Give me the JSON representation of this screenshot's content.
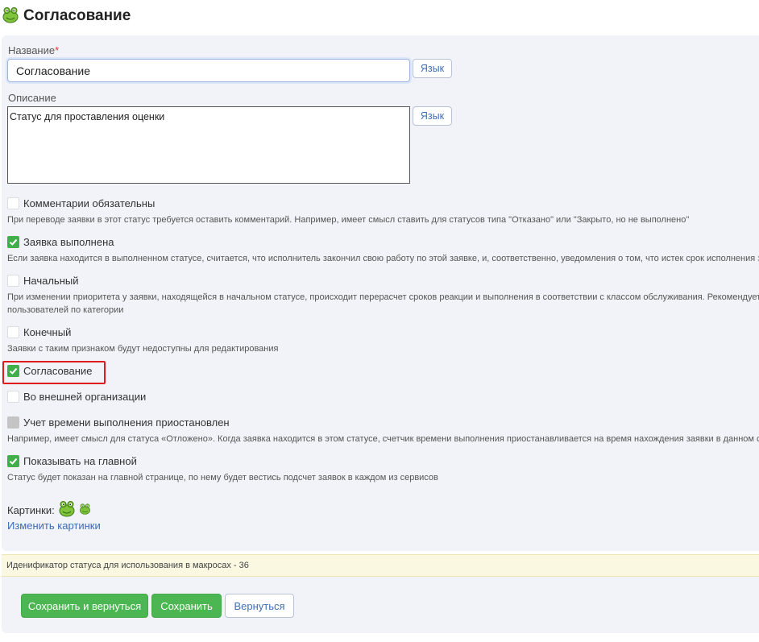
{
  "header": {
    "title": "Согласование",
    "icon": "frog-icon"
  },
  "form": {
    "name_label": "Название",
    "required_mark": "*",
    "name_value": "Согласование",
    "lang_label": "Язык",
    "description_label": "Описание",
    "description_value": "Статус для проставления оценки"
  },
  "options": [
    {
      "label": "Комментарии обязательны",
      "checked": false,
      "disabled": false,
      "hint": "При переводе заявки в этот статус требуется оставить комментарий. Например, имеет смысл ставить для статусов типа \"Отказано\" или \"Закрыто, но не выполнено\""
    },
    {
      "label": "Заявка выполнена",
      "checked": true,
      "disabled": false,
      "hint": "Если заявка находится в выполненном статусе, считается, что исполнитель закончил свою работу по этой заявке, и, соответственно, уведомления о том, что истек срок исполнения за"
    },
    {
      "label": "Начальный",
      "checked": false,
      "disabled": false,
      "hint": "При изменении приоритета у заявки, находящейся в начальном статусе, происходит перерасчет сроков реакции и выполнения в соответствии с классом обслуживания. Рекомендуетс",
      "hint2": "пользователей по категории"
    },
    {
      "label": "Конечный",
      "checked": false,
      "disabled": false,
      "hint": "Заявки с таким признаком будут недоступны для редактирования"
    },
    {
      "label": "Согласование",
      "checked": true,
      "disabled": false
    },
    {
      "label": "Во внешней организации",
      "checked": false,
      "disabled": false
    },
    {
      "label": "Учет времени выполнения приостановлен",
      "checked": false,
      "disabled": true,
      "hint": "Например, имеет смысл для статуса «Отложено». Когда заявка находится в этом статусе, счетчик времени выполнения приостанавливается на время нахождения заявки в данном стат"
    },
    {
      "label": "Показывать на главной",
      "checked": true,
      "disabled": false,
      "hint": "Статус будет показан на главной странице, по нему будет вестись подсчет заявок в каждом из сервисов"
    }
  ],
  "pictures": {
    "label": "Картинки:",
    "change_link": "Изменить картинки"
  },
  "info": "Иденификатор статуса для использования в макросах - 36",
  "buttons": {
    "save_return": "Сохранить и вернуться",
    "save": "Сохранить",
    "back": "Вернуться"
  },
  "colors": {
    "accent_green": "#4cb752",
    "link_blue": "#3b6bb5",
    "highlight_red": "#e01b1b",
    "info_bg": "#fbf8e2"
  }
}
